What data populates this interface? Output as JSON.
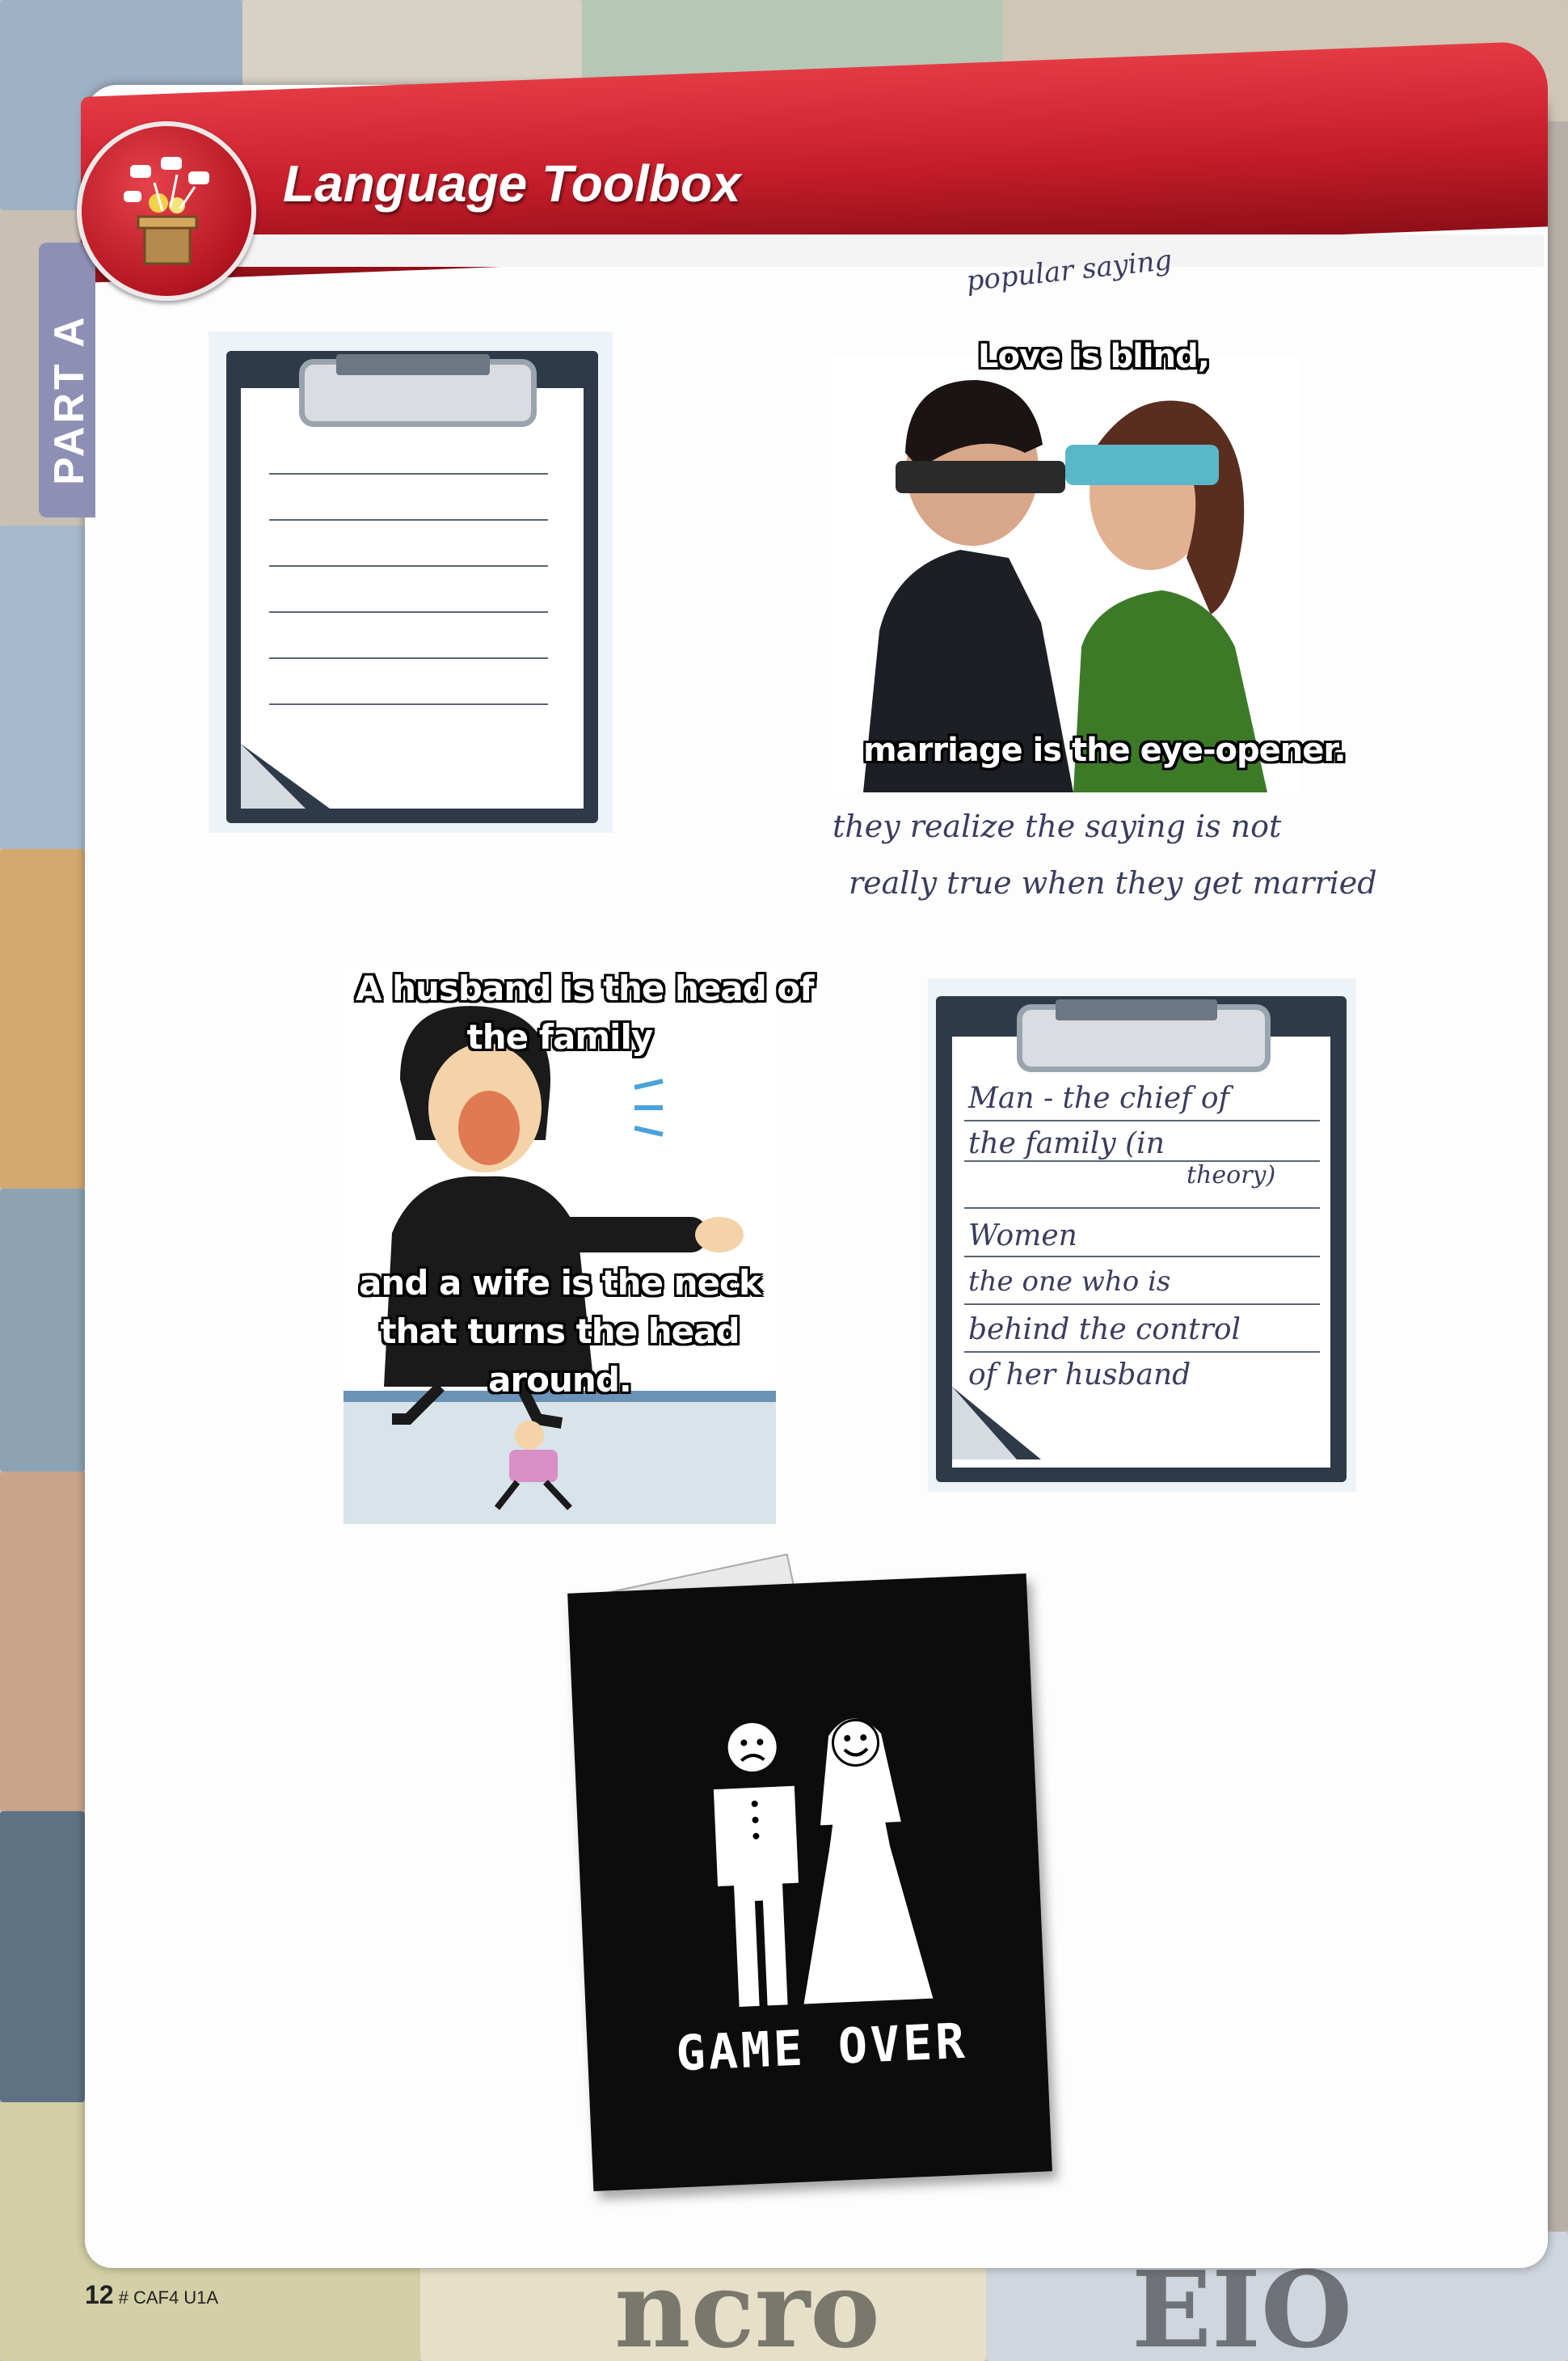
{
  "header": {
    "title": "Language Toolbox",
    "part_label": "PART A"
  },
  "saying1": {
    "handwritten_note": "popular saying",
    "top_line": "Love is blind,",
    "bottom_line": "marriage is the eye-opener.",
    "handwritten_line1": "they realize the saying is not",
    "handwritten_line2": "really true when they get married"
  },
  "saying2": {
    "line1": "A husband is the head of",
    "line2": "the family",
    "line3": "and a wife is the neck",
    "line4": "that turns the head",
    "line5": "around."
  },
  "clipboard_notes": {
    "line1": "Man - the chief of",
    "line2": "the family (in",
    "line3": "theory)",
    "line4": "Women",
    "line5": "the one who is",
    "line6": "behind the control",
    "line7": "of her husband"
  },
  "card": {
    "text": "GAME OVER"
  },
  "footer": {
    "page_number": "12",
    "code": "# CAF4 U1A"
  },
  "colors": {
    "banner_red": "#c51d2a",
    "part_tab": "#8d8fb4",
    "clipboard_frame": "#2e3a48"
  }
}
